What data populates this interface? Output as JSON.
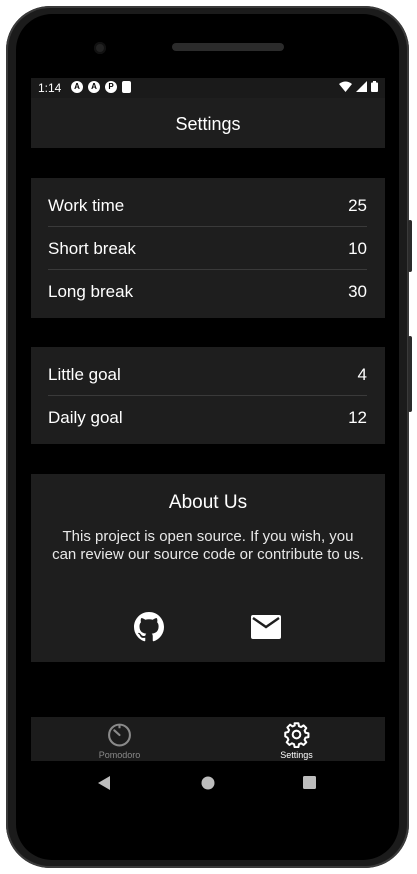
{
  "status_bar": {
    "time": "1:14",
    "notification_icons": [
      "app-notification-icon",
      "app-notification-icon",
      "app-notification-icon",
      "sd-card-icon"
    ],
    "system_icons": [
      "wifi-icon",
      "signal-icon",
      "battery-icon"
    ]
  },
  "app_bar": {
    "title": "Settings"
  },
  "timer_settings": [
    {
      "label": "Work time",
      "value": "25"
    },
    {
      "label": "Short break",
      "value": "10"
    },
    {
      "label": "Long break",
      "value": "30"
    }
  ],
  "goal_settings": [
    {
      "label": "Little goal",
      "value": "4"
    },
    {
      "label": "Daily goal",
      "value": "12"
    }
  ],
  "about": {
    "title": "About Us",
    "text": "This project is open source. If you wish, you can review our source code or contribute to us.",
    "links": [
      "github-icon",
      "mail-icon"
    ]
  },
  "bottom_nav": {
    "items": [
      {
        "label": "Pomodoro",
        "icon": "timer-icon",
        "active": false
      },
      {
        "label": "Settings",
        "icon": "gear-icon",
        "active": true
      }
    ]
  },
  "colors": {
    "background": "#000000",
    "card": "#1e1e1e",
    "text": "#ffffff",
    "inactive": "#8a8a8a",
    "divider": "#3a3a3a"
  }
}
